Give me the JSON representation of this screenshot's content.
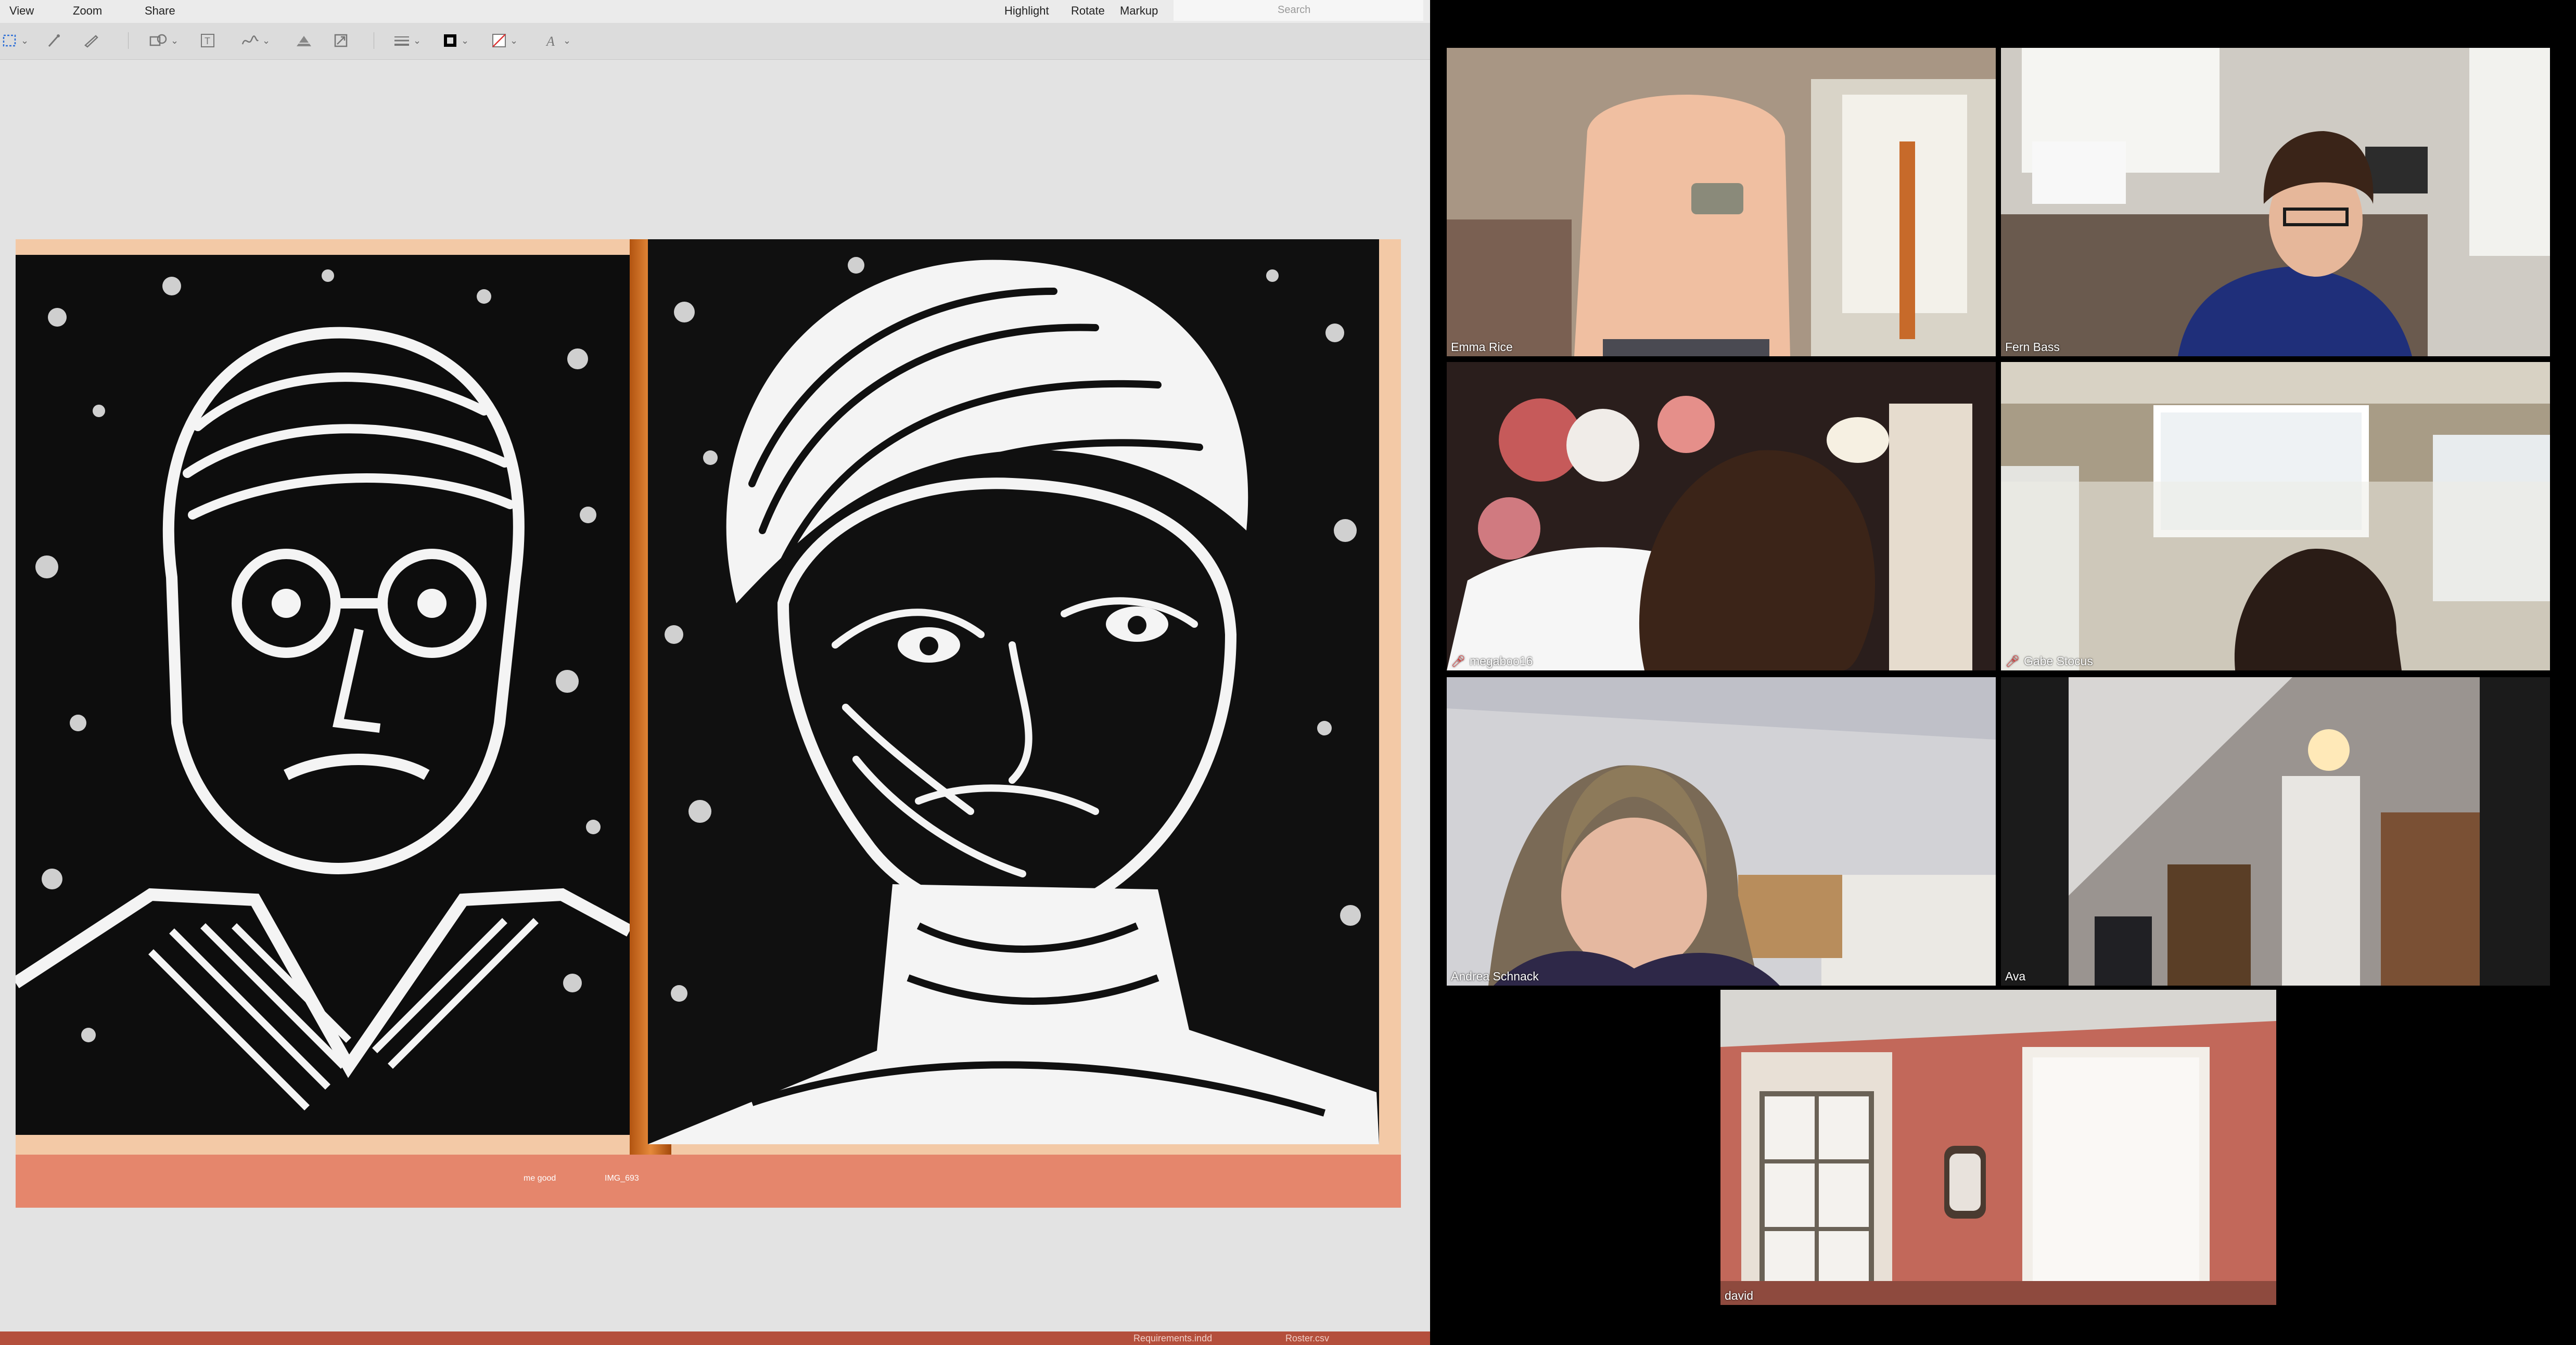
{
  "menubar": {
    "items": [
      "View",
      "Zoom",
      "Share"
    ],
    "right_items": [
      "Highlight",
      "Rotate",
      "Markup"
    ],
    "search_placeholder": "Search"
  },
  "toolbar": {
    "tools": [
      "rect-selection-icon",
      "magic-wand-icon",
      "sketch-icon",
      "shapes-icon",
      "text-box-icon",
      "sign-icon",
      "adjust-color-icon",
      "adjust-size-icon",
      "shape-style-icon",
      "border-color-icon",
      "fill-color-icon",
      "text-style-icon"
    ]
  },
  "document": {
    "file_captions": [
      "me good",
      "IMG_693"
    ],
    "colors": {
      "strip": "#e5866c",
      "wood": "#e5893a"
    }
  },
  "dock": {
    "items": [
      "Requirements.indd",
      "Roster.csv"
    ]
  },
  "participants": [
    {
      "name": "Emma Rice",
      "muted": false
    },
    {
      "name": "Fern Bass",
      "muted": false
    },
    {
      "name": "megaboo16",
      "muted": true
    },
    {
      "name": "Gabe Stocus",
      "muted": true
    },
    {
      "name": "Andrea Schnack",
      "muted": false
    },
    {
      "name": "Ava",
      "muted": false
    },
    {
      "name": "david",
      "muted": false,
      "active_speaker": true
    }
  ],
  "colors": {
    "active_speaker_border": "#c7d94d",
    "muted_mic": "#e23b3b"
  }
}
